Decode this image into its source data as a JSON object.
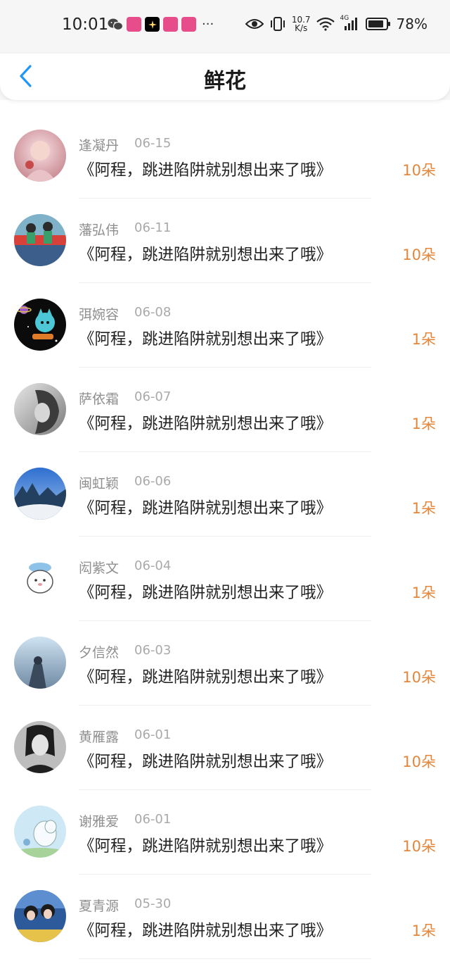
{
  "status_bar": {
    "time": "10:01",
    "net_speed_value": "10.7",
    "net_speed_unit": "K/s",
    "signal_label": "4G",
    "battery": "78%",
    "more": "···"
  },
  "header": {
    "title": "鲜花"
  },
  "colors": {
    "accent_blue": "#2196f3",
    "amount_orange": "#e6863a"
  },
  "rows": [
    {
      "name": "逢凝丹",
      "date": "06-15",
      "message": "《阿程，跳进陷阱就别想出来了哦》",
      "amount": "10朵"
    },
    {
      "name": "藩弘伟",
      "date": "06-11",
      "message": "《阿程，跳进陷阱就别想出来了哦》",
      "amount": "10朵"
    },
    {
      "name": "弭婉容",
      "date": "06-08",
      "message": "《阿程，跳进陷阱就别想出来了哦》",
      "amount": "1朵"
    },
    {
      "name": "萨依霜",
      "date": "06-07",
      "message": "《阿程，跳进陷阱就别想出来了哦》",
      "amount": "1朵"
    },
    {
      "name": "闽虹颖",
      "date": "06-06",
      "message": "《阿程，跳进陷阱就别想出来了哦》",
      "amount": "1朵"
    },
    {
      "name": "闳紫文",
      "date": "06-04",
      "message": "《阿程，跳进陷阱就别想出来了哦》",
      "amount": "1朵"
    },
    {
      "name": "夕信然",
      "date": "06-03",
      "message": "《阿程，跳进陷阱就别想出来了哦》",
      "amount": "10朵"
    },
    {
      "name": "黄雁露",
      "date": "06-01",
      "message": "《阿程，跳进陷阱就别想出来了哦》",
      "amount": "10朵"
    },
    {
      "name": "谢雅爱",
      "date": "06-01",
      "message": "《阿程，跳进陷阱就别想出来了哦》",
      "amount": "10朵"
    },
    {
      "name": "夏青源",
      "date": "05-30",
      "message": "《阿程，跳进陷阱就别想出来了哦》",
      "amount": "1朵"
    }
  ]
}
